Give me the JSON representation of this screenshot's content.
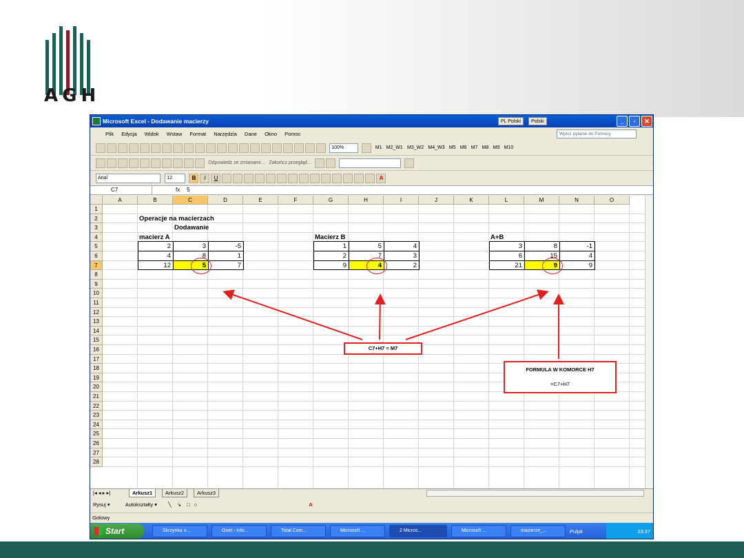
{
  "logo": {
    "text": "AGH"
  },
  "window": {
    "title": "Microsoft Excel - Dodawanie macierzy",
    "lang1": "PL Polski",
    "lang2": "Polski"
  },
  "menu": [
    "Plik",
    "Edycja",
    "Widok",
    "Wstaw",
    "Format",
    "Narzędzia",
    "Dane",
    "Okno",
    "Pomoc"
  ],
  "ask_placeholder": "Wpisz pytanie do Pomocy",
  "toolbar": {
    "zoom": "100%",
    "macros": [
      "M1",
      "M2_W1",
      "M3_W2",
      "M4_W3",
      "M5",
      "M6",
      "M7",
      "M8",
      "M9",
      "M10"
    ],
    "review_reply": "Odpowiedz ze zmianami...",
    "review_end": "Zakończ przegląd...",
    "font": "Arial",
    "size": "12"
  },
  "formula_bar": {
    "name": "C7",
    "fx": "fx",
    "value": "5"
  },
  "columns": [
    "A",
    "B",
    "C",
    "D",
    "E",
    "F",
    "G",
    "H",
    "I",
    "J",
    "K",
    "L",
    "M",
    "N",
    "O"
  ],
  "rows": [
    "1",
    "2",
    "3",
    "4",
    "5",
    "6",
    "7",
    "8",
    "9",
    "10",
    "11",
    "12",
    "13",
    "14",
    "15",
    "16",
    "17",
    "18",
    "19",
    "20",
    "21",
    "22",
    "23",
    "24",
    "25",
    "26",
    "27",
    "28"
  ],
  "sheet": {
    "title": "Operacje na macierzach",
    "subtitle": "Dodawanie",
    "labelA": "macierz A",
    "labelB": "Macierz B",
    "labelC": "A+B",
    "matrixA": [
      [
        "2",
        "3",
        "-5"
      ],
      [
        "4",
        "8",
        "1"
      ],
      [
        "12",
        "5",
        "7"
      ]
    ],
    "matrixB": [
      [
        "1",
        "5",
        "4"
      ],
      [
        "2",
        "7",
        "3"
      ],
      [
        "9",
        "4",
        "2"
      ]
    ],
    "matrixC": [
      [
        "3",
        "8",
        "-1"
      ],
      [
        "6",
        "15",
        "4"
      ],
      [
        "21",
        "9",
        "9"
      ]
    ]
  },
  "annotations": {
    "sum": "C7+H7 = M7",
    "formula_title": "FORMULA  W KOMORCE H7",
    "formula_value": "=C7+H7"
  },
  "sheet_tabs": [
    "Arkusz1",
    "Arkusz2",
    "Arkusz3"
  ],
  "draw": {
    "rysuj": "Rysuj",
    "autoshapes": "Autokształty"
  },
  "status": "Gotowy",
  "taskbar": {
    "start": "Start",
    "tasks": [
      "Skrzynka o...",
      "Onet - info...",
      "Total Com...",
      "Microsoft ...",
      "2 Micros...",
      "Microsoft ...",
      "macierze_..."
    ],
    "tray_label": "Pulpit",
    "clock": "23:37"
  }
}
